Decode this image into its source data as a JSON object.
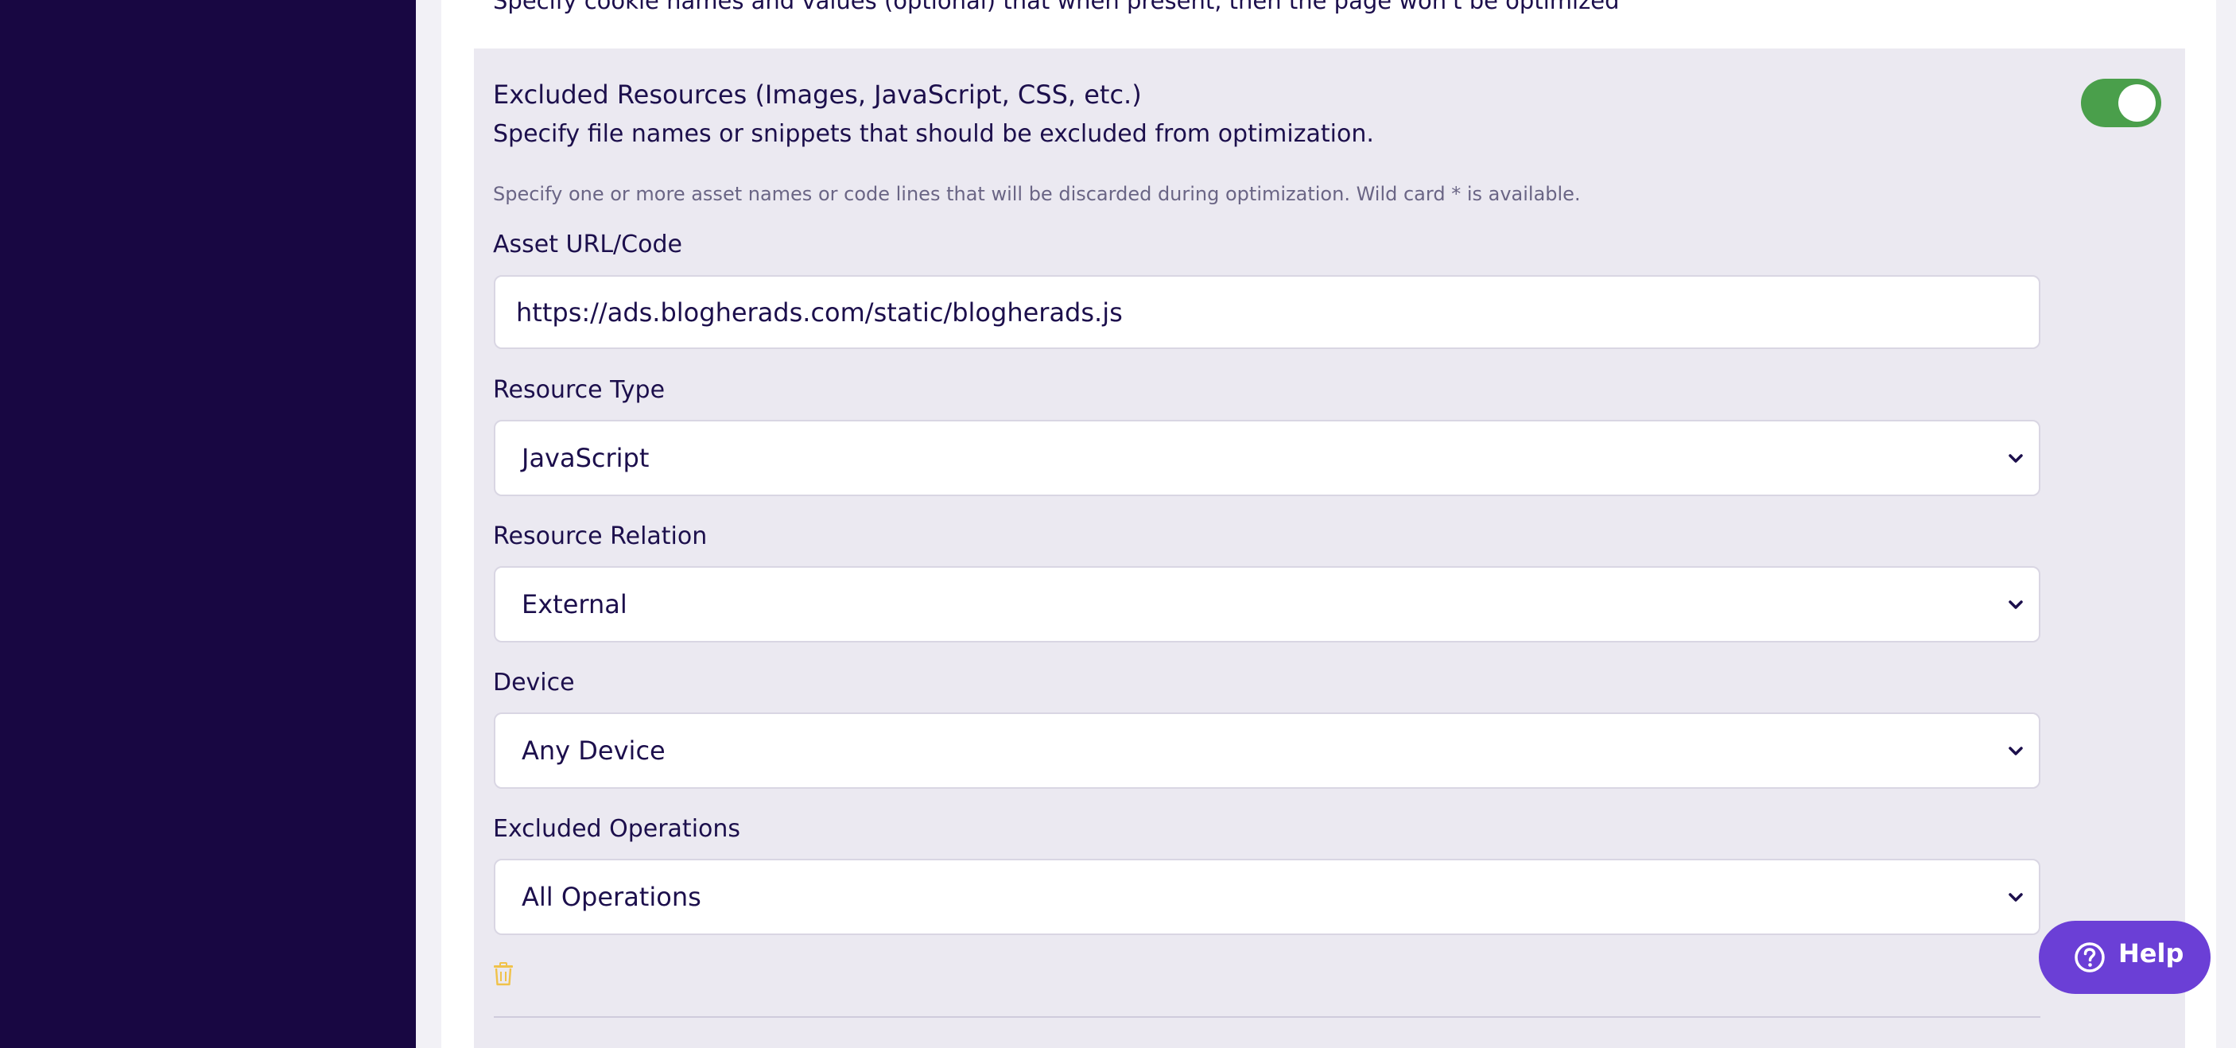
{
  "cookie_section": {
    "description": "Specify cookie names and values (optional) that when present, then the page won't be optimized"
  },
  "excluded_resources": {
    "title": "Excluded Resources (Images, JavaScript, CSS, etc.)",
    "subtitle": "Specify file names or snippets that should be excluded from optimization.",
    "enabled": true,
    "hint": "Specify one or more asset names or code lines that will be discarded during optimization. Wild card * is available.",
    "asset_url": {
      "label": "Asset URL/Code",
      "value": "https://ads.blogherads.com/static/blogherads.js"
    },
    "resource_type": {
      "label": "Resource Type",
      "selected": "JavaScript"
    },
    "resource_relation": {
      "label": "Resource Relation",
      "selected": "External"
    },
    "device": {
      "label": "Device",
      "selected": "Any Device"
    },
    "excluded_operations": {
      "label": "Excluded Operations",
      "selected": "All Operations"
    },
    "delete_icon": "trash-icon"
  },
  "help": {
    "label": "Help",
    "icon": "question-circle-icon"
  },
  "colors": {
    "sidebar": "#180742",
    "toggle_on": "#4a9f4b",
    "help_button": "#6b3fd6",
    "delete_icon": "#f0c24a"
  }
}
